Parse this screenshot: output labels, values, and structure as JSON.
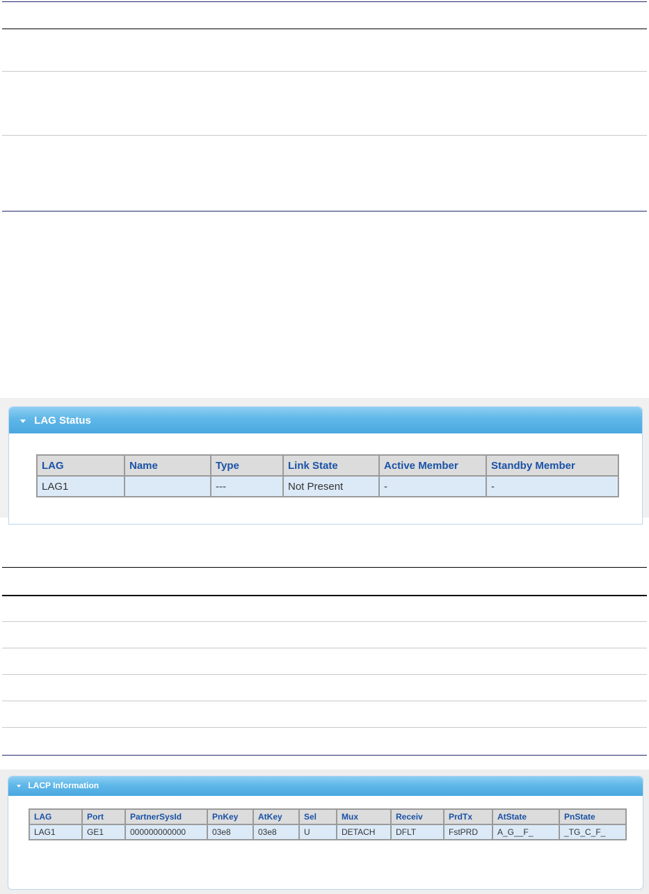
{
  "lag_status": {
    "title": "LAG Status",
    "columns": [
      "LAG",
      "Name",
      "Type",
      "Link State",
      "Active Member",
      "Standby Member"
    ],
    "rows": [
      [
        "LAG1",
        "",
        "---",
        "Not Present",
        "-",
        "-"
      ]
    ]
  },
  "lacp_information": {
    "title": "LACP Information",
    "columns": [
      "LAG",
      "Port",
      "PartnerSysId",
      "PnKey",
      "AtKey",
      "Sel",
      "Mux",
      "Receiv",
      "PrdTx",
      "AtState",
      "PnState"
    ],
    "rows": [
      [
        "LAG1",
        "GE1",
        "000000000000",
        "03e8",
        "03e8",
        "U",
        "DETACH",
        "DFLT",
        "FstPRD",
        "A_G__F_",
        "_TG_C_F_"
      ]
    ]
  },
  "colors": {
    "header_gradient": "#5fb7e8",
    "table_header_text": "#1a52a6",
    "table_header_bg": "#dcdcdc",
    "table_cell_bg": "#dceaf8",
    "rule_navy": "#1f2a6b"
  }
}
